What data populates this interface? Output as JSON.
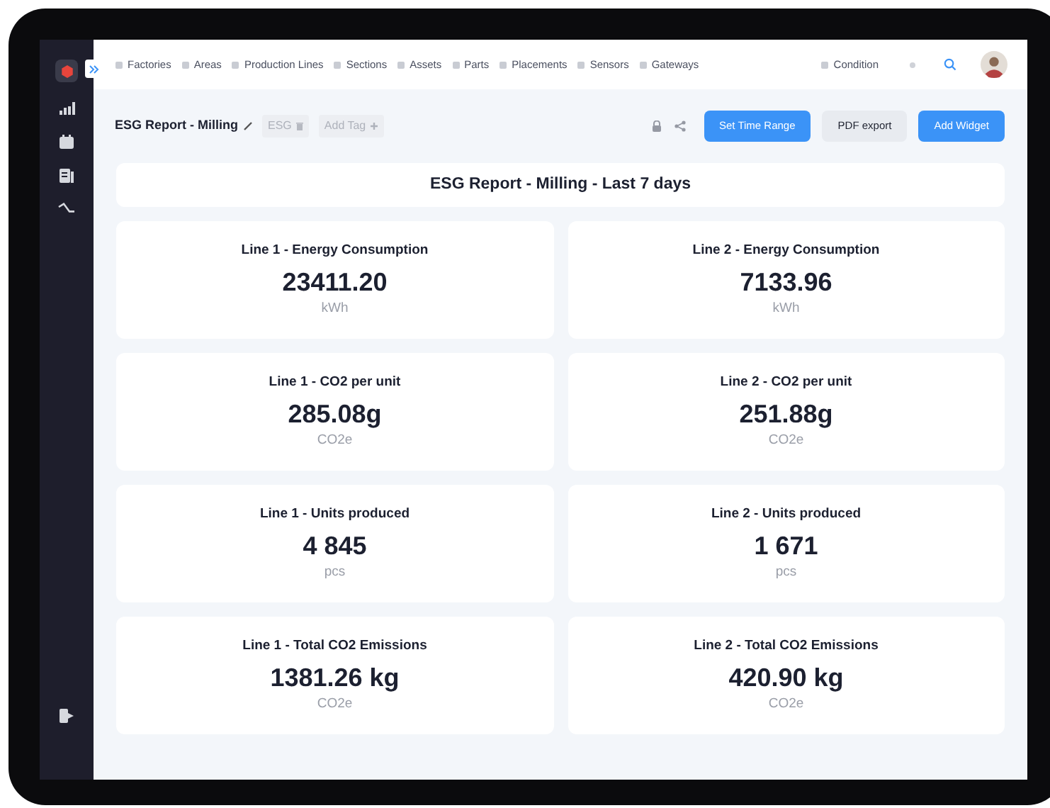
{
  "nav": {
    "items": [
      {
        "label": "Factories"
      },
      {
        "label": "Areas"
      },
      {
        "label": "Production Lines"
      },
      {
        "label": "Sections"
      },
      {
        "label": "Assets"
      },
      {
        "label": "Parts"
      },
      {
        "label": "Placements"
      },
      {
        "label": "Sensors"
      },
      {
        "label": "Gateways"
      }
    ],
    "condition": "Condition"
  },
  "header": {
    "title": "ESG Report - Milling",
    "tags": [
      {
        "label": "ESG",
        "kind": "tag"
      },
      {
        "label": "Add Tag",
        "kind": "add"
      }
    ],
    "buttons": [
      {
        "label": "Set Time Range",
        "kind": "primary"
      },
      {
        "label": "PDF export",
        "kind": "secondary"
      },
      {
        "label": "Add Widget",
        "kind": "primary"
      }
    ]
  },
  "report_title": "ESG Report - Milling - Last 7 days",
  "widgets": [
    {
      "title": "Line 1 - Energy Consumption",
      "value": "23411.20",
      "unit": "kWh"
    },
    {
      "title": "Line 2 - Energy Consumption",
      "value": "7133.96",
      "unit": "kWh"
    },
    {
      "title": "Line 1 - CO2 per unit",
      "value": "285.08g",
      "unit": "CO2e"
    },
    {
      "title": "Line 2 - CO2 per unit",
      "value": "251.88g",
      "unit": "CO2e"
    },
    {
      "title": "Line 1 - Units produced",
      "value": "4 845",
      "unit": "pcs"
    },
    {
      "title": "Line 2 - Units produced",
      "value": "1 671",
      "unit": "pcs"
    },
    {
      "title": "Line 1 - Total CO2 Emissions",
      "value": "1381.26 kg",
      "unit": "CO2e"
    },
    {
      "title": "Line 2 - Total CO2 Emissions",
      "value": "420.90 kg",
      "unit": "CO2e"
    }
  ]
}
